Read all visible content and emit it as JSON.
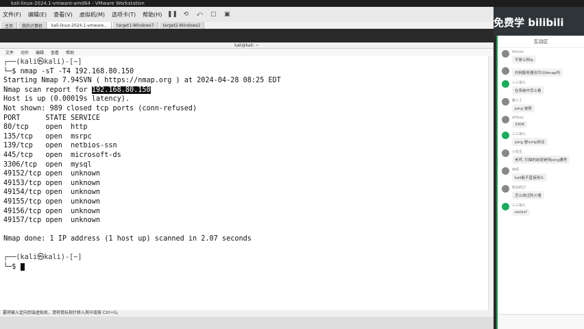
{
  "vmware": {
    "title": "kali-linux-2024.1-vmware-amd64 - VMware Workstation",
    "menu": [
      "文件(F)",
      "编辑(E)",
      "查看(V)",
      "虚拟机(M)",
      "选项卡(T)",
      "帮助(H)"
    ],
    "tabs": [
      {
        "label": "主页"
      },
      {
        "label": "我的计算机"
      },
      {
        "label": "kali-linux-2024.1-vmware..."
      },
      {
        "label": "target1-Windows7"
      },
      {
        "label": "target2-Windows2"
      }
    ],
    "status": "要将输入定向到该虚拟机，请将鼠标指针移入其中或按 Ctrl+G。"
  },
  "kali": {
    "window_title": "kali@kali: ~",
    "menu": [
      "文件",
      "动作",
      "编辑",
      "查看",
      "帮助"
    ]
  },
  "terminal": {
    "prompt_user": "kali",
    "prompt_host": "kali",
    "prompt_dir": "~",
    "command": "nmap -sT -T4 192.168.80.150",
    "line_starting": "Starting Nmap 7.94SVN ( https://nmap.org ) at 2024-04-28 08:25 EDT",
    "scan_report_prefix": "Nmap scan report for ",
    "scan_report_ip": "192.168.80.150",
    "host_up": "Host is up (0.00019s latency).",
    "not_shown": "Not shown: 989 closed tcp ports (conn-refused)",
    "header": "PORT      STATE SERVICE",
    "ports": [
      "80/tcp    open  http",
      "135/tcp   open  msrpc",
      "139/tcp   open  netbios-ssn",
      "445/tcp   open  microsoft-ds",
      "3306/tcp  open  mysql",
      "49152/tcp open  unknown",
      "49153/tcp open  unknown",
      "49154/tcp open  unknown",
      "49155/tcp open  unknown",
      "49156/tcp open  unknown",
      "49157/tcp open  unknown"
    ],
    "done": "Nmap done: 1 IP address (1 host up) scanned in 2.07 seconds"
  },
  "overlay": {
    "bili_text": "免费学 bilibili",
    "chat_title": "互动区",
    "messages": [
      {
        "name": "Alecka",
        "text": "不是公网ip"
      },
      {
        "name": "",
        "text": "内网服务器也可以Nmap吗"
      },
      {
        "name": "三三得九",
        "text": "在系统中怎么看"
      },
      {
        "name": "路人丁",
        "text": "ping 被禁"
      },
      {
        "name": "AtTaxa",
        "text": "3306"
      },
      {
        "name": "三三得九",
        "text": "ping 是icmp协议"
      },
      {
        "name": "小花生",
        "text": "老师, 扫描的前提是得ping通吧"
      },
      {
        "name": "钟师",
        "text": "kali能不直接用么"
      },
      {
        "name": "知识的力",
        "text": "怎么绕过防火墙"
      },
      {
        "name": "三三得九",
        "text": "socks?"
      }
    ]
  }
}
